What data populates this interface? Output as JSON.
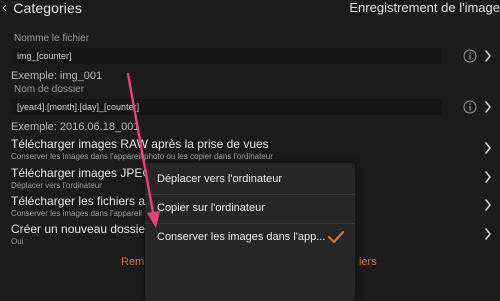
{
  "header": {
    "back_label": "Categories",
    "title": "Enregistrement de l'image"
  },
  "file_name": {
    "label": "Nomme le fichier",
    "value": "img_[counter]",
    "example": "Exemple: img_001"
  },
  "folder_name": {
    "label": "Nom de dossier",
    "value": "[year4].[month].[day]_[counter]",
    "example": "Exemple: 2016.06.18_001"
  },
  "settings_rows": [
    {
      "title": "Télécharger images RAW après la prise de vues",
      "subtitle": "Conserver les images dans l'appareil photo ou les copier dans l'ordinateur"
    },
    {
      "title": "Télécharger images JPEG a",
      "subtitle": "Déplacer vers l'ordinateur"
    },
    {
      "title": "Télécharger les fichiers apr",
      "subtitle": "Conserver les images dans l'appareil"
    },
    {
      "title": "Créer un nouveau dossier p",
      "subtitle": "Oui"
    }
  ],
  "bottom_actions": {
    "left_text": "Rem",
    "right_text": "iers"
  },
  "popup_menu": {
    "items": [
      {
        "label": "Déplacer vers l'ordinateur"
      },
      {
        "label": "Copier sur l'ordinateur"
      },
      {
        "label": "Conserver les images dans l'app..."
      }
    ]
  },
  "colors": {
    "accent": "#d9732c",
    "annotation_arrow": "#e8407a",
    "background": "#1b1b1c"
  }
}
